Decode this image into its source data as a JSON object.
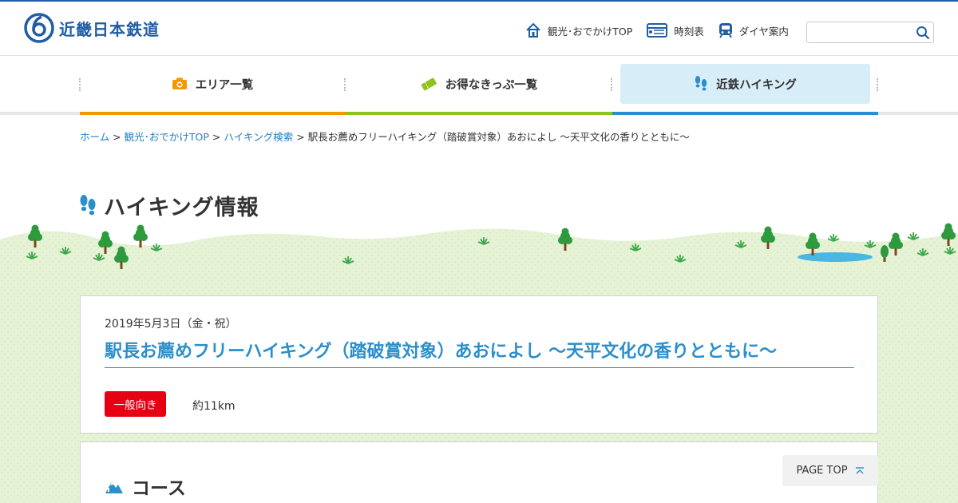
{
  "header": {
    "logo_text": "近畿日本鉄道",
    "util_links": [
      {
        "label": "観光･おでかけTOP",
        "icon": "home-icon"
      },
      {
        "label": "時刻表",
        "icon": "timetable-icon"
      },
      {
        "label": "ダイヤ案内",
        "icon": "train-icon"
      }
    ],
    "search": {
      "placeholder": "",
      "value": ""
    }
  },
  "global_nav": {
    "items": [
      {
        "label": "エリア一覧",
        "icon": "camera-icon",
        "color": "#f39800"
      },
      {
        "label": "お得なきっぷ一覧",
        "icon": "ticket-icon",
        "color": "#8fc31f"
      },
      {
        "label": "近鉄ハイキング",
        "icon": "footprints-icon",
        "color": "#2b8fcb",
        "active": true
      }
    ]
  },
  "breadcrumb": {
    "items": [
      "ホーム",
      "観光･おでかけTOP",
      "ハイキング検索"
    ],
    "current": "駅長お薦めフリーハイキング（踏破賞対象）あおによし 〜天平文化の香りとともに〜",
    "separator": ">"
  },
  "page": {
    "title": "ハイキング情報"
  },
  "event": {
    "date": "2019年5月3日（金・祝）",
    "title": "駅長お薦めフリーハイキング（踏破賞対象）あおによし 〜天平文化の香りとともに〜",
    "difficulty": "一般向き",
    "distance": "約11km"
  },
  "course": {
    "heading": "コース"
  },
  "page_top_label": "PAGE TOP",
  "colors": {
    "brand": "#1f5da4",
    "accent_blue": "#2b8fcb",
    "badge_red": "#e60012",
    "grass": "#e8f3da"
  }
}
